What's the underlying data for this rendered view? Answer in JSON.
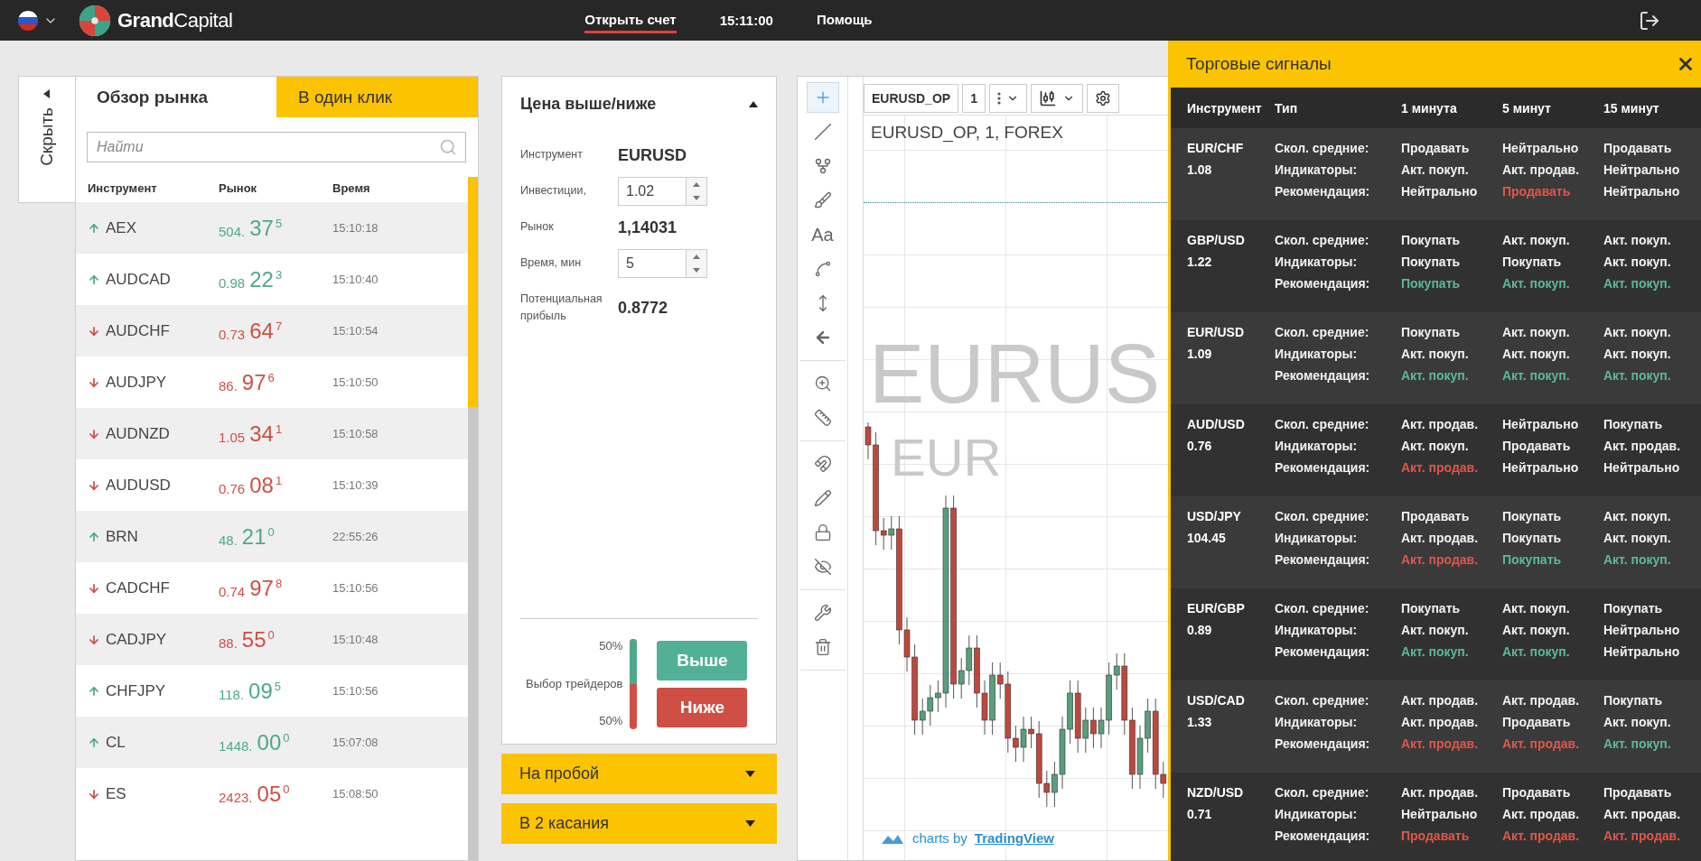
{
  "top_bar": {
    "logo": {
      "bold": "Grand",
      "light": "Capital"
    },
    "nav": [
      {
        "label": "Открыть счет",
        "selected": true
      },
      {
        "label": "Помощь",
        "selected": false
      }
    ],
    "clock": "15:11:00"
  },
  "side_toggle": {
    "label": "Скрыть"
  },
  "market": {
    "tabs": [
      {
        "label": "Обзор рынка",
        "selected": true
      },
      {
        "label": "В один клик",
        "selected": false
      }
    ],
    "search": {
      "placeholder": "Найти"
    },
    "columns": [
      "Инструмент",
      "Рынок",
      "Время"
    ],
    "rows": [
      {
        "instrument": "AEX",
        "rising": true,
        "price_head": "504.",
        "price_big": "37",
        "price_tail": "5",
        "time": "15:10:18"
      },
      {
        "instrument": "AUDCAD",
        "rising": true,
        "price_head": "0.98",
        "price_big": "22",
        "price_tail": "3",
        "time": "15:10:40"
      },
      {
        "instrument": "AUDCHF",
        "rising": false,
        "price_head": "0.73",
        "price_big": "64",
        "price_tail": "7",
        "time": "15:10:54"
      },
      {
        "instrument": "AUDJPY",
        "rising": false,
        "price_head": "86.",
        "price_big": "97",
        "price_tail": "6",
        "time": "15:10:50"
      },
      {
        "instrument": "AUDNZD",
        "rising": false,
        "price_head": "1.05",
        "price_big": "34",
        "price_tail": "1",
        "time": "15:10:58"
      },
      {
        "instrument": "AUDUSD",
        "rising": false,
        "price_head": "0.76",
        "price_big": "08",
        "price_tail": "1",
        "time": "15:10:39"
      },
      {
        "instrument": "BRN",
        "rising": true,
        "price_head": "48.",
        "price_big": "21",
        "price_tail": "0",
        "time": "22:55:26"
      },
      {
        "instrument": "CADCHF",
        "rising": false,
        "price_head": "0.74",
        "price_big": "97",
        "price_tail": "8",
        "time": "15:10:56"
      },
      {
        "instrument": "CADJPY",
        "rising": false,
        "price_head": "88.",
        "price_big": "55",
        "price_tail": "0",
        "time": "15:10:48"
      },
      {
        "instrument": "CHFJPY",
        "rising": true,
        "price_head": "118.",
        "price_big": "09",
        "price_tail": "5",
        "time": "15:10:56"
      },
      {
        "instrument": "CL",
        "rising": true,
        "price_head": "1448.",
        "price_big": "00",
        "price_tail": "0",
        "time": "15:07:08"
      },
      {
        "instrument": "ES",
        "rising": false,
        "price_head": "2423.",
        "price_big": "05",
        "price_tail": "0",
        "time": "15:08:50"
      }
    ]
  },
  "trade": {
    "title": "Цена выше/ниже",
    "expanded": true,
    "fields": [
      {
        "kind": "text",
        "label": "Инструмент",
        "value": "EURUSD"
      },
      {
        "kind": "spinner",
        "label": "Инвестиции,",
        "value": "1.02"
      },
      {
        "kind": "text",
        "label": "Рынок",
        "value": "1,14031"
      },
      {
        "kind": "spinner",
        "label": "Время, мин",
        "value": "5"
      },
      {
        "kind": "text",
        "label": "Потенциальная прибыль",
        "value": "0.8772"
      }
    ],
    "traders": {
      "label": "Выбор трейдеров",
      "up_reading": "50%",
      "down_reading": "50%",
      "level": 0.5
    },
    "buttons": [
      {
        "label": "Выше",
        "color": "#52b097"
      },
      {
        "label": "Ниже",
        "color": "#cf4f45"
      }
    ]
  },
  "other_options": [
    {
      "title": "На пробой",
      "expanded": false
    },
    {
      "title": "В 2 касания",
      "expanded": false
    }
  ],
  "chart": {
    "symbol": "EURUSD_OP",
    "interval": "1",
    "legend": "EURUSD_OP, 1, FOREX",
    "watermark": [
      "EURUS",
      "EUR"
    ],
    "credit": "charts by",
    "credit_link": "TradingView",
    "tool_groups": [
      [
        {
          "kind": "crosshair",
          "selected": true
        },
        {
          "kind": "line",
          "selected": false
        },
        {
          "kind": "pitchfork",
          "selected": false
        },
        {
          "kind": "brush",
          "selected": false
        },
        {
          "kind": "text",
          "label": "Aa",
          "selected": false
        },
        {
          "kind": "pattern",
          "selected": false
        },
        {
          "kind": "measure",
          "selected": false
        },
        {
          "kind": "back",
          "selected": false
        }
      ],
      [
        {
          "kind": "zoom",
          "selected": false
        },
        {
          "kind": "ruler",
          "selected": false
        }
      ],
      [
        {
          "kind": "magnet",
          "selected": false
        },
        {
          "kind": "pencil",
          "selected": false
        },
        {
          "kind": "lock",
          "selected": false
        },
        {
          "kind": "hide",
          "selected": false
        }
      ],
      [
        {
          "kind": "tools",
          "selected": false
        },
        {
          "kind": "trash",
          "selected": false
        }
      ]
    ]
  },
  "signals": {
    "title": "Торговые сигналы",
    "columns": [
      "Инструмент",
      "Тип",
      "1 минута",
      "5 минут",
      "15 минут"
    ],
    "groups": [
      {
        "pair": "EUR/CHF",
        "rate": "1.08",
        "rows": [
          {
            "label": "Скол. средние:",
            "cells": [
              {
                "text": "Продавать",
                "color": "#f2f2f2"
              },
              {
                "text": "Нейтрально",
                "color": "#f2f2f2"
              },
              {
                "text": "Продавать",
                "color": "#f2f2f2"
              }
            ]
          },
          {
            "label": "Индикаторы:",
            "cells": [
              {
                "text": "Акт. покуп.",
                "color": "#f2f2f2"
              },
              {
                "text": "Акт. продав.",
                "color": "#f2f2f2"
              },
              {
                "text": "Нейтрально",
                "color": "#f2f2f2"
              }
            ]
          },
          {
            "label": "Рекомендация:",
            "cells": [
              {
                "text": "Нейтрально",
                "color": "#f2f2f2"
              },
              {
                "text": "Продавать",
                "color": "#e0564b"
              },
              {
                "text": "Нейтрально",
                "color": "#f2f2f2"
              }
            ]
          }
        ]
      },
      {
        "pair": "GBP/USD",
        "rate": "1.22",
        "rows": [
          {
            "label": "Скол. средние:",
            "cells": [
              {
                "text": "Покупать",
                "color": "#f2f2f2"
              },
              {
                "text": "Акт. покуп.",
                "color": "#f2f2f2"
              },
              {
                "text": "Акт. покуп.",
                "color": "#f2f2f2"
              }
            ]
          },
          {
            "label": "Индикаторы:",
            "cells": [
              {
                "text": "Покупать",
                "color": "#f2f2f2"
              },
              {
                "text": "Покупать",
                "color": "#f2f2f2"
              },
              {
                "text": "Акт. покуп.",
                "color": "#f2f2f2"
              }
            ]
          },
          {
            "label": "Рекомендация:",
            "cells": [
              {
                "text": "Покупать",
                "color": "#5cb89b"
              },
              {
                "text": "Акт. покуп.",
                "color": "#5cb89b"
              },
              {
                "text": "Акт. покуп.",
                "color": "#5cb89b"
              }
            ]
          }
        ]
      },
      {
        "pair": "EUR/USD",
        "rate": "1.09",
        "rows": [
          {
            "label": "Скол. средние:",
            "cells": [
              {
                "text": "Покупать",
                "color": "#f2f2f2"
              },
              {
                "text": "Акт. покуп.",
                "color": "#f2f2f2"
              },
              {
                "text": "Акт. покуп.",
                "color": "#f2f2f2"
              }
            ]
          },
          {
            "label": "Индикаторы:",
            "cells": [
              {
                "text": "Акт. покуп.",
                "color": "#f2f2f2"
              },
              {
                "text": "Акт. покуп.",
                "color": "#f2f2f2"
              },
              {
                "text": "Акт. покуп.",
                "color": "#f2f2f2"
              }
            ]
          },
          {
            "label": "Рекомендация:",
            "cells": [
              {
                "text": "Акт. покуп.",
                "color": "#5cb89b"
              },
              {
                "text": "Акт. покуп.",
                "color": "#5cb89b"
              },
              {
                "text": "Акт. покуп.",
                "color": "#5cb89b"
              }
            ]
          }
        ]
      },
      {
        "pair": "AUD/USD",
        "rate": "0.76",
        "rows": [
          {
            "label": "Скол. средние:",
            "cells": [
              {
                "text": "Акт. продав.",
                "color": "#f2f2f2"
              },
              {
                "text": "Нейтрально",
                "color": "#f2f2f2"
              },
              {
                "text": "Покупать",
                "color": "#f2f2f2"
              }
            ]
          },
          {
            "label": "Индикаторы:",
            "cells": [
              {
                "text": "Акт. покуп.",
                "color": "#f2f2f2"
              },
              {
                "text": "Продавать",
                "color": "#f2f2f2"
              },
              {
                "text": "Акт. продав.",
                "color": "#f2f2f2"
              }
            ]
          },
          {
            "label": "Рекомендация:",
            "cells": [
              {
                "text": "Акт. продав.",
                "color": "#e0564b"
              },
              {
                "text": "Нейтрально",
                "color": "#f2f2f2"
              },
              {
                "text": "Нейтрально",
                "color": "#f2f2f2"
              }
            ]
          }
        ]
      },
      {
        "pair": "USD/JPY",
        "rate": "104.45",
        "rows": [
          {
            "label": "Скол. средние:",
            "cells": [
              {
                "text": "Продавать",
                "color": "#f2f2f2"
              },
              {
                "text": "Покупать",
                "color": "#f2f2f2"
              },
              {
                "text": "Акт. покуп.",
                "color": "#f2f2f2"
              }
            ]
          },
          {
            "label": "Индикаторы:",
            "cells": [
              {
                "text": "Акт. продав.",
                "color": "#f2f2f2"
              },
              {
                "text": "Покупать",
                "color": "#f2f2f2"
              },
              {
                "text": "Акт. покуп.",
                "color": "#f2f2f2"
              }
            ]
          },
          {
            "label": "Рекомендация:",
            "cells": [
              {
                "text": "Акт. продав.",
                "color": "#e0564b"
              },
              {
                "text": "Покупать",
                "color": "#5cb89b"
              },
              {
                "text": "Акт. покуп.",
                "color": "#5cb89b"
              }
            ]
          }
        ]
      },
      {
        "pair": "EUR/GBP",
        "rate": "0.89",
        "rows": [
          {
            "label": "Скол. средние:",
            "cells": [
              {
                "text": "Покупать",
                "color": "#f2f2f2"
              },
              {
                "text": "Акт. покуп.",
                "color": "#f2f2f2"
              },
              {
                "text": "Покупать",
                "color": "#f2f2f2"
              }
            ]
          },
          {
            "label": "Индикаторы:",
            "cells": [
              {
                "text": "Акт. покуп.",
                "color": "#f2f2f2"
              },
              {
                "text": "Акт. покуп.",
                "color": "#f2f2f2"
              },
              {
                "text": "Нейтрально",
                "color": "#f2f2f2"
              }
            ]
          },
          {
            "label": "Рекомендация:",
            "cells": [
              {
                "text": "Акт. покуп.",
                "color": "#5cb89b"
              },
              {
                "text": "Акт. покуп.",
                "color": "#5cb89b"
              },
              {
                "text": "Нейтрально",
                "color": "#f2f2f2"
              }
            ]
          }
        ]
      },
      {
        "pair": "USD/CAD",
        "rate": "1.33",
        "rows": [
          {
            "label": "Скол. средние:",
            "cells": [
              {
                "text": "Акт. продав.",
                "color": "#f2f2f2"
              },
              {
                "text": "Акт. продав.",
                "color": "#f2f2f2"
              },
              {
                "text": "Покупать",
                "color": "#f2f2f2"
              }
            ]
          },
          {
            "label": "Индикаторы:",
            "cells": [
              {
                "text": "Акт. продав.",
                "color": "#f2f2f2"
              },
              {
                "text": "Продавать",
                "color": "#f2f2f2"
              },
              {
                "text": "Акт. покуп.",
                "color": "#f2f2f2"
              }
            ]
          },
          {
            "label": "Рекомендация:",
            "cells": [
              {
                "text": "Акт. продав.",
                "color": "#e0564b"
              },
              {
                "text": "Акт. продав.",
                "color": "#e0564b"
              },
              {
                "text": "Акт. покуп.",
                "color": "#5cb89b"
              }
            ]
          }
        ]
      },
      {
        "pair": "NZD/USD",
        "rate": "0.71",
        "rows": [
          {
            "label": "Скол. средние:",
            "cells": [
              {
                "text": "Акт. продав.",
                "color": "#f2f2f2"
              },
              {
                "text": "Продавать",
                "color": "#f2f2f2"
              },
              {
                "text": "Продавать",
                "color": "#f2f2f2"
              }
            ]
          },
          {
            "label": "Индикаторы:",
            "cells": [
              {
                "text": "Нейтрально",
                "color": "#f2f2f2"
              },
              {
                "text": "Акт. продав.",
                "color": "#f2f2f2"
              },
              {
                "text": "Акт. продав.",
                "color": "#f2f2f2"
              }
            ]
          },
          {
            "label": "Рекомендация:",
            "cells": [
              {
                "text": "Продавать",
                "color": "#e0564b"
              },
              {
                "text": "Акт. продав.",
                "color": "#e0564b"
              },
              {
                "text": "Акт. продав.",
                "color": "#e0564b"
              }
            ]
          }
        ]
      }
    ]
  }
}
